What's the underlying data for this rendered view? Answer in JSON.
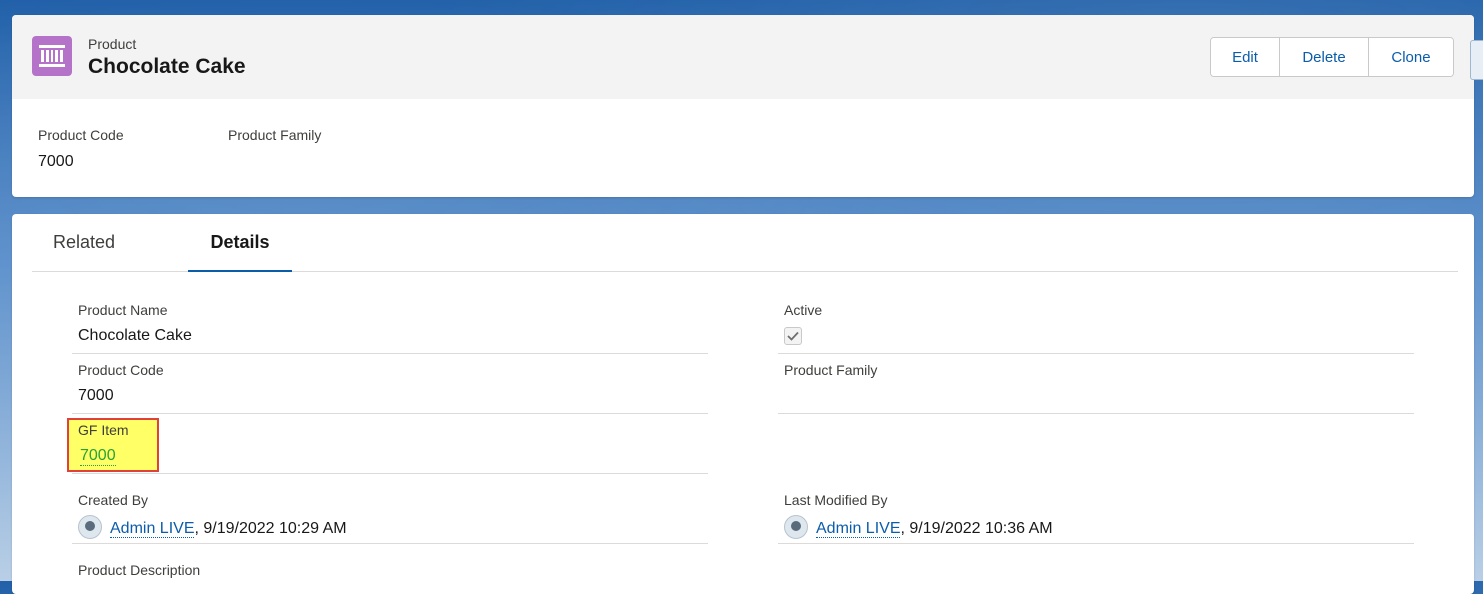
{
  "header": {
    "object_type": "Product",
    "record_title": "Chocolate Cake",
    "icon": "product-barcode-icon",
    "icon_color": "#b472c9",
    "buttons": {
      "edit": "Edit",
      "delete": "Delete",
      "clone": "Clone"
    },
    "highlights": [
      {
        "label": "Product Code",
        "value": "7000"
      },
      {
        "label": "Product Family",
        "value": ""
      }
    ]
  },
  "tabs": {
    "related": "Related",
    "details": "Details",
    "active": "Details"
  },
  "details": {
    "product_name": {
      "label": "Product Name",
      "value": "Chocolate Cake"
    },
    "active": {
      "label": "Active",
      "checked": true
    },
    "product_code": {
      "label": "Product Code",
      "value": "7000"
    },
    "product_family": {
      "label": "Product Family",
      "value": ""
    },
    "gf_item": {
      "label": "GF Item",
      "value": "7000"
    },
    "created_by": {
      "label": "Created By",
      "user": "Admin LIVE",
      "date": ", 9/19/2022 10:29 AM"
    },
    "last_modified_by": {
      "label": "Last Modified By",
      "user": "Admin LIVE",
      "date": ", 9/19/2022 10:36 AM"
    },
    "product_description": {
      "label": "Product Description"
    }
  },
  "colors": {
    "link": "#0b5cab",
    "highlight_fill": "#ffff66",
    "highlight_border": "#e0413b",
    "gf_link": "#2aa236"
  }
}
